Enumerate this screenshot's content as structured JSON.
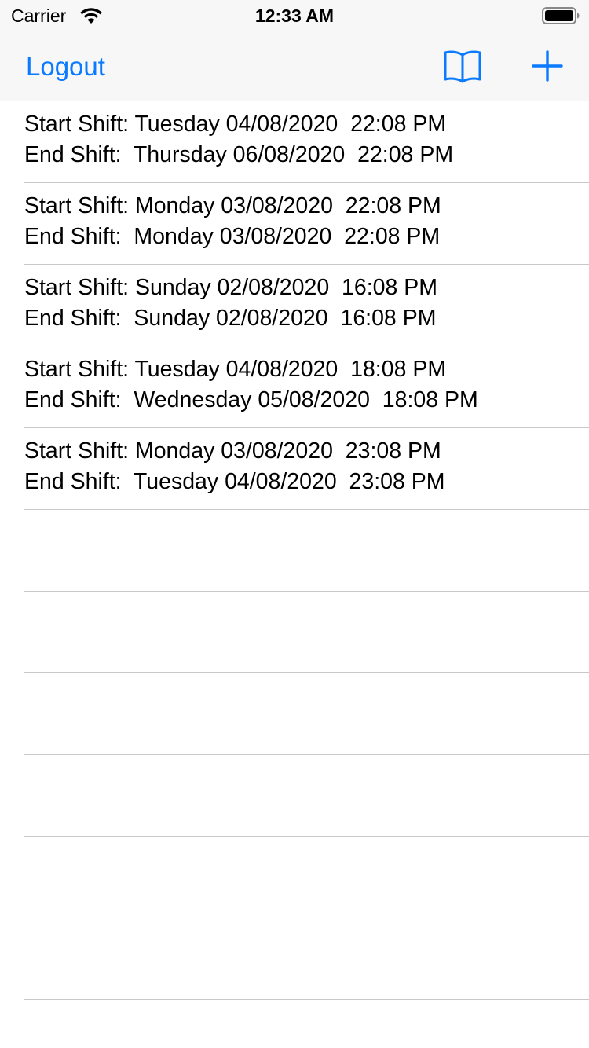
{
  "status_bar": {
    "carrier": "Carrier",
    "time": "12:33 AM",
    "wifi_icon": "wifi-icon",
    "battery_icon": "battery-icon"
  },
  "nav_bar": {
    "logout_label": "Logout",
    "book_icon": "book-icon",
    "add_icon": "plus-icon",
    "accent_color": "#0a7aff"
  },
  "shifts": [
    {
      "start": "Start Shift: Tuesday 04/08/2020  22:08 PM",
      "end": "End Shift:  Thursday 06/08/2020  22:08 PM"
    },
    {
      "start": "Start Shift: Monday 03/08/2020  22:08 PM",
      "end": "End Shift:  Monday 03/08/2020  22:08 PM"
    },
    {
      "start": "Start Shift: Sunday 02/08/2020  16:08 PM",
      "end": "End Shift:  Sunday 02/08/2020  16:08 PM"
    },
    {
      "start": "Start Shift: Tuesday 04/08/2020  18:08 PM",
      "end": "End Shift:  Wednesday 05/08/2020  18:08 PM"
    },
    {
      "start": "Start Shift: Monday 03/08/2020  23:08 PM",
      "end": "End Shift:  Tuesday 04/08/2020  23:08 PM"
    }
  ]
}
